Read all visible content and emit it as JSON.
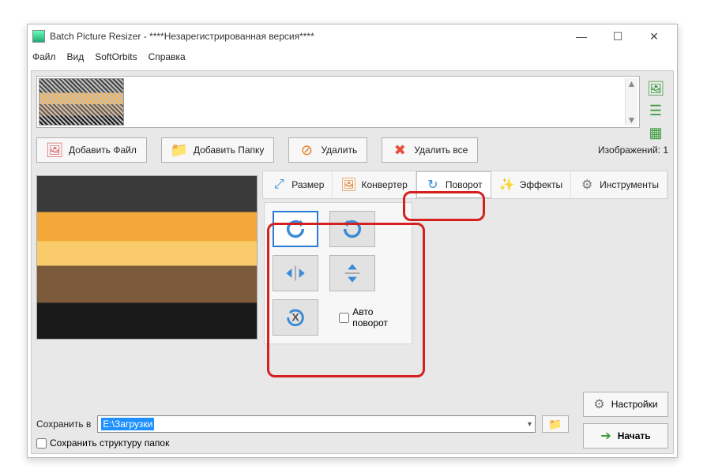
{
  "window": {
    "title": "Batch Picture Resizer - ****Незарегистрированная версия****"
  },
  "menu": {
    "file": "Файл",
    "view": "Вид",
    "softorbits": "SoftOrbits",
    "help": "Справка"
  },
  "toolbar": {
    "add_file": "Добавить Файл",
    "add_folder": "Добавить Папку",
    "delete": "Удалить",
    "delete_all": "Удалить все",
    "count_label": "Изображений: 1"
  },
  "tabs": {
    "resize": "Размер",
    "convert": "Конвертер",
    "rotate": "Поворот",
    "effects": "Эффекты",
    "tools": "Инструменты"
  },
  "rotate_panel": {
    "auto_label": "Авто поворот",
    "auto_checked": false
  },
  "save": {
    "label": "Сохранить в",
    "path": "E:\\Загрузки",
    "keep_structure": "Сохранить структуру папок",
    "keep_checked": false
  },
  "buttons": {
    "settings": "Настройки",
    "start": "Начать"
  }
}
